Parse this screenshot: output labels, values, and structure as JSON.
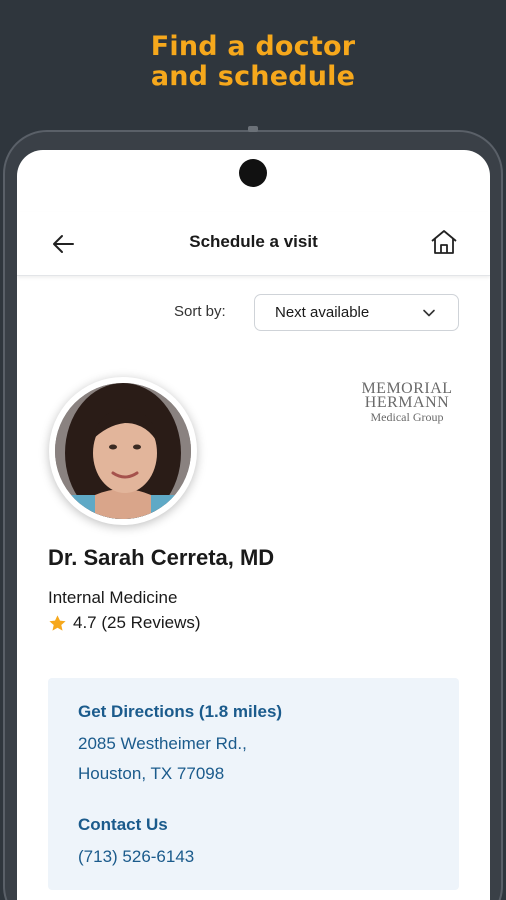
{
  "promo": {
    "line1": "Find a doctor",
    "line2": "and schedule"
  },
  "appbar": {
    "title": "Schedule a visit",
    "back_icon": "arrow-left-icon",
    "home_icon": "home-icon"
  },
  "sort": {
    "label": "Sort by:",
    "value": "Next available"
  },
  "logo": {
    "line1": "MEMORIAL",
    "line2": "HERMANN",
    "line3": "Medical Group"
  },
  "doctor": {
    "name": "Dr. Sarah Cerreta, MD",
    "specialty": "Internal Medicine",
    "rating": "4.7 (25 Reviews)"
  },
  "location": {
    "directions": "Get Directions (1.8 miles)",
    "address_line1": "2085 Westheimer Rd.,",
    "address_line2": "Houston, TX 77098",
    "contact_label": "Contact Us",
    "phone": "(713) 526-6143"
  },
  "colors": {
    "accent": "#f6a81c",
    "link": "#1b5b8c",
    "card_bg": "#eef4fa",
    "background": "#2f363d"
  }
}
